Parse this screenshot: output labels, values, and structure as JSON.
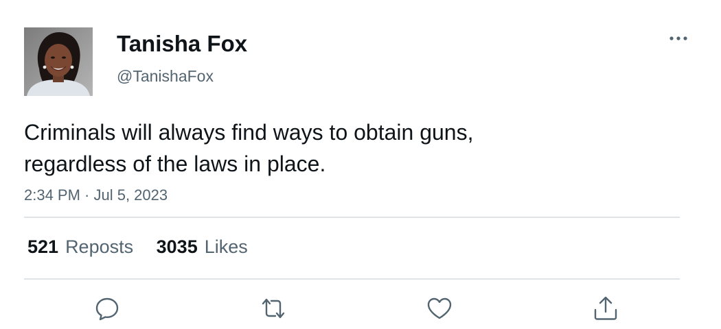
{
  "author": {
    "display_name": "Tanisha Fox",
    "handle": "@TanishaFox"
  },
  "tweet": {
    "text_lines": [
      "Criminals will always find ways to obtain guns,",
      "regardless of the laws in place."
    ],
    "timestamp": "2:34 PM · Jul 5, 2023"
  },
  "stats": {
    "reposts_count": "521",
    "reposts_label": "Reposts",
    "likes_count": "3035",
    "likes_label": "Likes"
  },
  "icons": {
    "more": "more-horizontal-icon",
    "reply": "reply-icon",
    "repost": "repost-icon",
    "like": "heart-icon",
    "share": "share-icon"
  },
  "colors": {
    "text_primary": "#0f1419",
    "text_secondary": "#536471",
    "divider": "#dfe3e6"
  }
}
